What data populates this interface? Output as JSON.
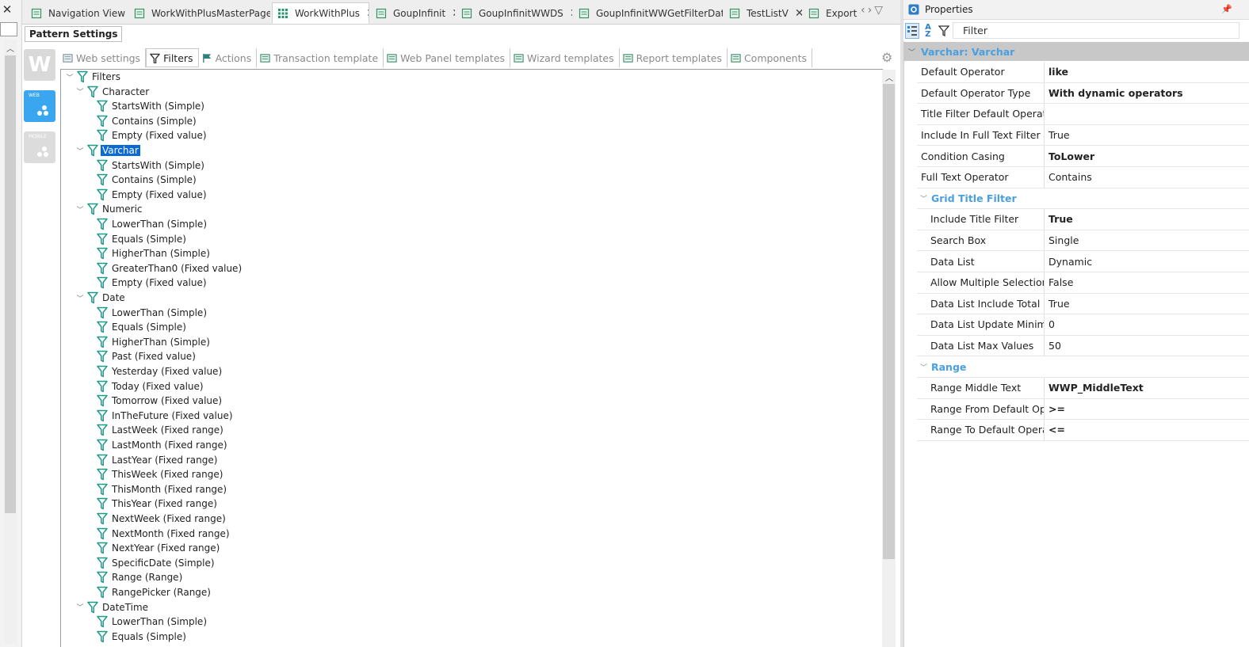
{
  "tabs": [
    {
      "label": "Navigation View",
      "icon": "document-icon"
    },
    {
      "label": "WorkWithPlusMasterPage",
      "icon": "webpanel-icon"
    },
    {
      "label": "WorkWithPlus",
      "icon": "grid-pattern-icon"
    },
    {
      "label": "GoupInfinit",
      "icon": "transaction-icon"
    },
    {
      "label": "GoupInfinitWWDS",
      "icon": "dataprovider-icon"
    },
    {
      "label": "GoupInfinitWWGetFilterData",
      "icon": "procedure-icon"
    },
    {
      "label": "TestListV",
      "icon": "webpanel-icon"
    },
    {
      "label": "Export G",
      "icon": "export-icon"
    }
  ],
  "pattern_settings_title": "Pattern Settings",
  "pattern_icons": [
    "W",
    "WEB",
    "MOBILE"
  ],
  "toolbar": [
    {
      "label": "Web settings"
    },
    {
      "label": "Filters"
    },
    {
      "label": "Actions"
    },
    {
      "label": "Transaction template"
    },
    {
      "label": "Web Panel templates"
    },
    {
      "label": "Wizard templates"
    },
    {
      "label": "Report templates"
    },
    {
      "label": "Components"
    }
  ],
  "tree": [
    {
      "label": "Filters",
      "level": 0,
      "toggle": "v"
    },
    {
      "label": "Character",
      "level": 1,
      "toggle": "v"
    },
    {
      "label": "StartsWith (Simple)",
      "level": 2
    },
    {
      "label": "Contains (Simple)",
      "level": 2
    },
    {
      "label": "Empty (Fixed value)",
      "level": 2
    },
    {
      "label": "Varchar",
      "level": 1,
      "toggle": "v",
      "selected": true
    },
    {
      "label": "StartsWith (Simple)",
      "level": 2
    },
    {
      "label": "Contains (Simple)",
      "level": 2
    },
    {
      "label": "Empty (Fixed value)",
      "level": 2
    },
    {
      "label": "Numeric",
      "level": 1,
      "toggle": "v"
    },
    {
      "label": "LowerThan (Simple)",
      "level": 2
    },
    {
      "label": "Equals (Simple)",
      "level": 2
    },
    {
      "label": "HigherThan (Simple)",
      "level": 2
    },
    {
      "label": "GreaterThan0 (Fixed value)",
      "level": 2
    },
    {
      "label": "Empty (Fixed value)",
      "level": 2
    },
    {
      "label": "Date",
      "level": 1,
      "toggle": "v"
    },
    {
      "label": "LowerThan (Simple)",
      "level": 2
    },
    {
      "label": "Equals (Simple)",
      "level": 2
    },
    {
      "label": "HigherThan (Simple)",
      "level": 2
    },
    {
      "label": "Past (Fixed value)",
      "level": 2
    },
    {
      "label": "Yesterday (Fixed value)",
      "level": 2
    },
    {
      "label": "Today (Fixed value)",
      "level": 2
    },
    {
      "label": "Tomorrow (Fixed value)",
      "level": 2
    },
    {
      "label": "InTheFuture (Fixed value)",
      "level": 2
    },
    {
      "label": "LastWeek (Fixed range)",
      "level": 2
    },
    {
      "label": "LastMonth (Fixed range)",
      "level": 2
    },
    {
      "label": "LastYear (Fixed range)",
      "level": 2
    },
    {
      "label": "ThisWeek (Fixed range)",
      "level": 2
    },
    {
      "label": "ThisMonth (Fixed range)",
      "level": 2
    },
    {
      "label": "ThisYear (Fixed range)",
      "level": 2
    },
    {
      "label": "NextWeek (Fixed range)",
      "level": 2
    },
    {
      "label": "NextMonth (Fixed range)",
      "level": 2
    },
    {
      "label": "NextYear (Fixed range)",
      "level": 2
    },
    {
      "label": "SpecificDate (Simple)",
      "level": 2
    },
    {
      "label": "Range (Range)",
      "level": 2
    },
    {
      "label": "RangePicker (Range)",
      "level": 2
    },
    {
      "label": "DateTime",
      "level": 1,
      "toggle": "v"
    },
    {
      "label": "LowerThan (Simple)",
      "level": 2
    },
    {
      "label": "Equals (Simple)",
      "level": 2
    }
  ],
  "properties": {
    "title": "Properties",
    "filter_placeholder": "Filter",
    "object_header": "Varchar: Varchar",
    "rows": [
      {
        "type": "prop",
        "name": "Default Operator",
        "value": "like",
        "bold": true
      },
      {
        "type": "prop",
        "name": "Default Operator Type",
        "value": "With dynamic operators",
        "bold": true
      },
      {
        "type": "prop",
        "name": "Title Filter Default Operator",
        "value": ""
      },
      {
        "type": "prop",
        "name": "Include In Full Text Filter",
        "value": "True"
      },
      {
        "type": "prop",
        "name": "Condition Casing",
        "value": "ToLower",
        "bold": true
      },
      {
        "type": "prop",
        "name": "Full Text Operator",
        "value": "Contains"
      },
      {
        "type": "group",
        "name": "Grid Title Filter"
      },
      {
        "type": "prop",
        "sub": true,
        "name": "Include Title Filter",
        "value": "True",
        "bold": true
      },
      {
        "type": "prop",
        "sub": true,
        "name": "Search Box",
        "value": "Single"
      },
      {
        "type": "prop",
        "sub": true,
        "name": "Data List",
        "value": "Dynamic"
      },
      {
        "type": "prop",
        "sub": true,
        "name": "Allow Multiple Selection",
        "value": "False"
      },
      {
        "type": "prop",
        "sub": true,
        "name": "Data List Include Total Reco",
        "value": "True"
      },
      {
        "type": "prop",
        "sub": true,
        "name": "Data List Update Minimum",
        "value": "0"
      },
      {
        "type": "prop",
        "sub": true,
        "name": "Data List Max Values",
        "value": "50"
      },
      {
        "type": "group",
        "name": "Range"
      },
      {
        "type": "prop",
        "sub": true,
        "name": "Range Middle Text",
        "value": "WWP_MiddleText",
        "bold": true
      },
      {
        "type": "prop",
        "sub": true,
        "name": "Range From Default Opera",
        "value": ">=",
        "bold": true
      },
      {
        "type": "prop",
        "sub": true,
        "name": "Range To Default Operator",
        "value": "<=",
        "bold": true
      }
    ]
  },
  "colors": {
    "accent": "#4a9fde",
    "selection": "#0a6bd6",
    "filter_icon": "#1f9a8a"
  }
}
